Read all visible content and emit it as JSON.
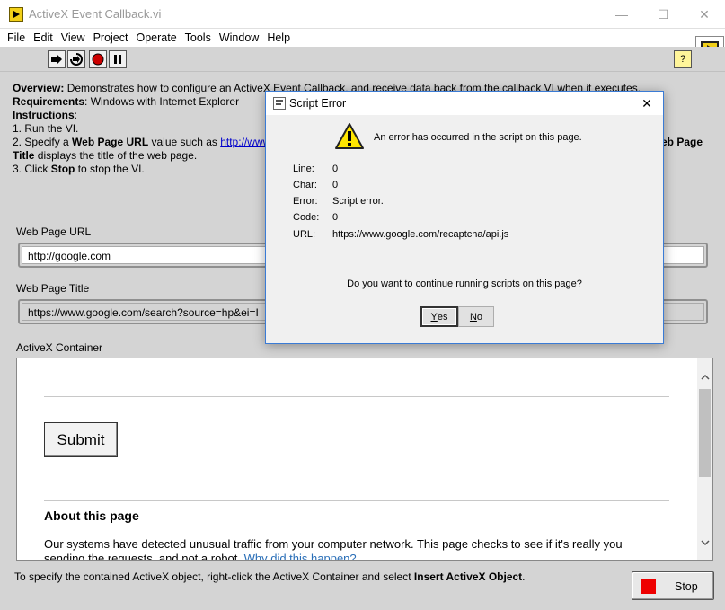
{
  "window": {
    "title": "ActiveX Event Callback.vi",
    "minimize": "—",
    "maximize": "☐",
    "close": "✕"
  },
  "menu": [
    "File",
    "Edit",
    "View",
    "Project",
    "Operate",
    "Tools",
    "Window",
    "Help"
  ],
  "toolbar": {
    "run_icon": "run-arrow-icon",
    "run_continuous_icon": "run-continuously-icon",
    "abort_icon": "abort-icon",
    "pause_icon": "pause-icon",
    "help_label": "?"
  },
  "instructions": {
    "overview_label": "Overview:",
    "overview_text": " Demonstrates how to configure an ActiveX Event Callback, and receive data back from the callback VI when it executes.",
    "requirements_label": "Requirements",
    "requirements_text": ": Windows with Internet Explorer",
    "instructions_label": "Instructions",
    "instructions_colon": ":",
    "step1": "1. Run the VI.",
    "step2_prefix": "2. Specify a ",
    "step2_bold": "Web Page URL",
    "step2_middle": " value such as ",
    "step2_link": "http://www",
    "step2_right_bold": "eb Page",
    "step2_line2_bold": "Title",
    "step2_line2_text": " displays the title of the web page.",
    "step3_prefix": "3. Click ",
    "step3_bold": "Stop",
    "step3_suffix": " to stop the VI."
  },
  "url_field": {
    "label": "Web Page URL",
    "value": "http://google.com"
  },
  "title_field": {
    "label": "Web Page Title",
    "value": "https://www.google.com/search?source=hp&ei=I"
  },
  "container": {
    "label": "ActiveX Container",
    "submit_label": "Submit",
    "about_title": "About this page",
    "about_text": "Our systems have detected unusual traffic from your computer network. This page checks to see if it's really you sending the requests, and not a robot. ",
    "about_link": "Why did this happen?"
  },
  "bottom_note": {
    "prefix": "To specify the contained ActiveX object, right-click the ActiveX Container and select ",
    "bold": "Insert ActiveX Object",
    "suffix": "."
  },
  "stop_button": {
    "label": "Stop",
    "color": "#ee0000"
  },
  "dialog": {
    "title": "Script Error",
    "close": "✕",
    "message": "An error has occurred in the script on this page.",
    "rows": [
      {
        "key": "Line:",
        "value": "0"
      },
      {
        "key": "Char:",
        "value": "0"
      },
      {
        "key": "Error:",
        "value": "Script error."
      },
      {
        "key": "Code:",
        "value": "0"
      },
      {
        "key": "URL:",
        "value": "https://www.google.com/recaptcha/api.js"
      }
    ],
    "question": "Do you want to continue running scripts on this page?",
    "yes_mnemonic": "Y",
    "yes_rest": "es",
    "no_mnemonic": "N",
    "no_rest": "o",
    "icon": "warning-icon"
  }
}
